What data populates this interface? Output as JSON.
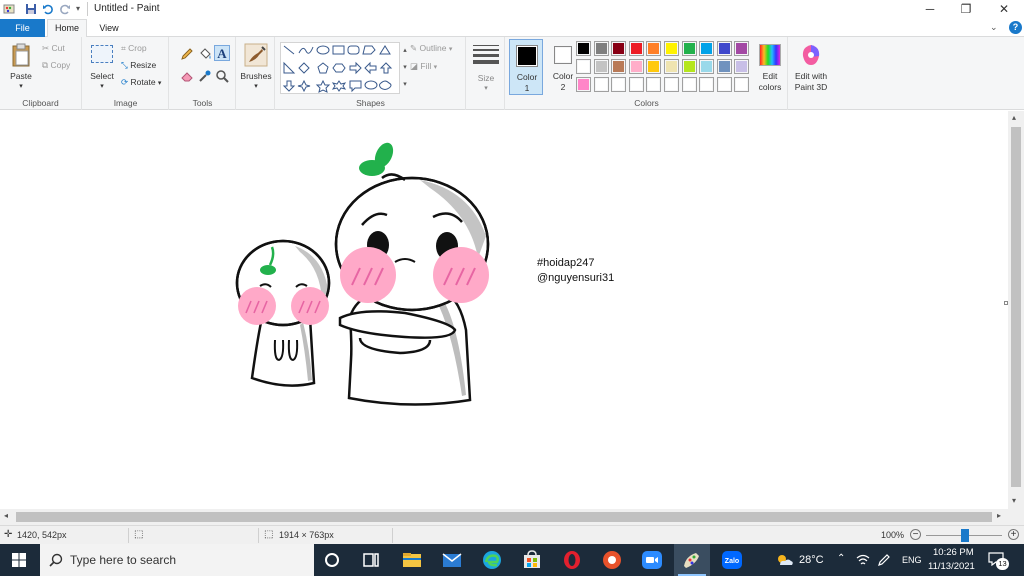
{
  "window": {
    "title": "Untitled - Paint"
  },
  "tabs": {
    "file": "File",
    "home": "Home",
    "view": "View"
  },
  "ribbon": {
    "clipboard": {
      "paste": "Paste",
      "cut": "Cut",
      "copy": "Copy",
      "label": "Clipboard"
    },
    "image": {
      "select": "Select",
      "crop": "Crop",
      "resize": "Resize",
      "rotate": "Rotate",
      "label": "Image"
    },
    "tools": {
      "label": "Tools"
    },
    "brushes": {
      "label": "Brushes"
    },
    "shapes": {
      "outline": "Outline",
      "fill": "Fill",
      "label": "Shapes"
    },
    "size": {
      "label": "Size"
    },
    "colors": {
      "color1": "Color 1",
      "color1_line1": "Color",
      "color1_line2": "1",
      "color2_line1": "Color",
      "color2_line2": "2",
      "edit_line1": "Edit",
      "edit_line2": "colors",
      "label": "Colors",
      "color1_value": "#000000",
      "color2_value": "#ffffff",
      "palette_row1": [
        "#000000",
        "#7f7f7f",
        "#880015",
        "#ed1c24",
        "#ff7f27",
        "#fff200",
        "#22b14c",
        "#00a2e8",
        "#3f48cc",
        "#a349a4"
      ],
      "palette_row2": [
        "#ffffff",
        "#c3c3c3",
        "#b97a57",
        "#ffaec9",
        "#ffc90e",
        "#efe4b0",
        "#b5e61d",
        "#99d9ea",
        "#7092be",
        "#c8bfe7"
      ],
      "palette_row3": [
        "#ff85c8",
        "#ffffff",
        "#ffffff",
        "#ffffff",
        "#ffffff",
        "#ffffff",
        "#ffffff",
        "#ffffff",
        "#ffffff",
        "#ffffff"
      ]
    },
    "paint3d": {
      "line1": "Edit with",
      "line2": "Paint 3D"
    }
  },
  "canvas": {
    "text_line1": "#hoidap247",
    "text_line2": "@nguyensuri31"
  },
  "status": {
    "cursor_pos": "1420, 542px",
    "canvas_size": "1914 × 763px",
    "zoom": "100%"
  },
  "taskbar": {
    "search_placeholder": "Type here to search",
    "weather": "28°C",
    "language": "ENG",
    "time": "10:26 PM",
    "date": "11/13/2021",
    "notifications": "13"
  }
}
